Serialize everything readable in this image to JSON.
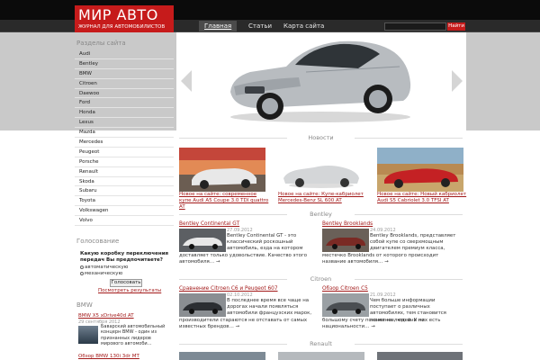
{
  "header": {
    "logo_title": "МИР АВТО",
    "logo_subtitle": "ЖУРНАЛ ДЛЯ АВТОМОБИЛИСТОВ",
    "nav": [
      "Главная",
      "Статьи",
      "Карта сайта"
    ],
    "search_button": "Найти"
  },
  "sidebar": {
    "sections_title": "Разделы сайта",
    "brands": [
      "Audi",
      "Bentley",
      "BMW",
      "Citroen",
      "Daewoo",
      "Ford",
      "Honda",
      "Lexus",
      "Mazda",
      "Mercedes",
      "Peugeot",
      "Porsche",
      "Renault",
      "Skoda",
      "Subaru",
      "Toyota",
      "Volkswagen",
      "Volvo"
    ],
    "poll_title": "Голосование",
    "poll_question": "Какую коробку переключения передач Вы предпочитаете?",
    "poll_options": [
      "автоматическую",
      "механическую"
    ],
    "poll_button": "Голосовать",
    "poll_results": "Посмотреть результаты",
    "bmw_section": "BMW",
    "bmw_article_title": "BMW X5 xDrive40d AT",
    "bmw_article_date": "29 сентября 2012",
    "bmw_article_text": "Баварский автомобильный концерн BMW - один из признанных лидеров мирового автомоби…",
    "bmw_article2_title": "Обзор BMW 130i 3dr MT"
  },
  "main": {
    "news_title": "Новости",
    "news": [
      "Новое на сайте: современное купе Audi A5 Coupe 3.0 TDI quattro AT",
      "Новое на сайте: Купе-кабриолет Mercedes-Benz SL 600 AT",
      "Новое на сайте: Новый кабриолет Audi S5 Cabriolet 3.0 TFSI AT"
    ],
    "bentley_title": "Bentley",
    "bentley_articles": [
      {
        "title": "Bentley Continental GT",
        "date": "27.09.2012",
        "text_side": "Bentley Continental GT - это классический роскошный автомобиль, езда на котором",
        "text_full": "доставляет только удовольствие. Качество этого автомобиля… →"
      },
      {
        "title": "Bentley Brooklands",
        "date": "24.09.2012",
        "text_side": "Bentley Brooklands, представляет собой купе со сверхмощным двигателем премиум класса,",
        "text_full": "местечко Brooklands от которого происходит название автомобиля… →"
      }
    ],
    "citroen_title": "Citroen",
    "citroen_articles": [
      {
        "title": "Сравнение Citroen C6 и Peugeot 607",
        "date": "02.10.2012",
        "text_side": "В последнее время все чаще на дорогах начали появляться автомобили французских марок,",
        "text_full": "производители стараются не отставать от самых известных брендов… →"
      },
      {
        "title": "Обзор Citroen C5",
        "date": "21.09.2012",
        "text_side": "Чем больше информации поступает о различных автомобилях, тем становится понятнее, что они по",
        "text_full": "большому счету похожи на людей. У них есть национальности… →"
      }
    ],
    "renault_title": "Renault"
  }
}
